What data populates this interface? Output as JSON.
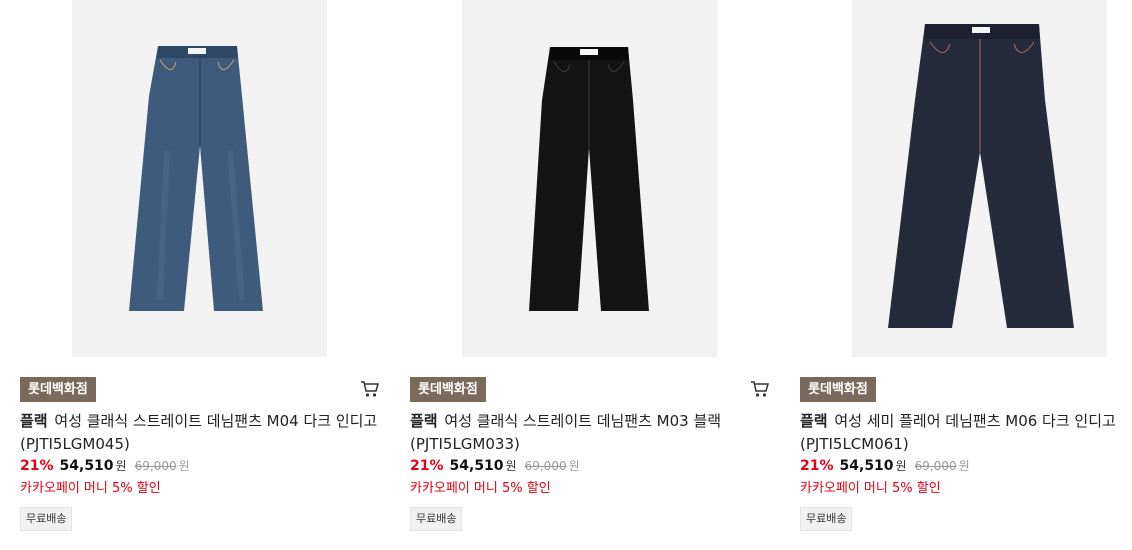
{
  "products": [
    {
      "badge": "롯데백화점",
      "brand": "플랙",
      "name": "여성 클래식 스트레이트 데님팬츠 M04 다크 인디고 (PJTI5LGM045)",
      "discount": "21%",
      "sale_price": "54,510",
      "sale_unit": "원",
      "original_price": "69,000",
      "original_unit": "원",
      "promo": "카카오페이 머니 5% 할인",
      "shipping": "무료배송",
      "image_icon": "jeans-mid-blue",
      "has_cart": true
    },
    {
      "badge": "롯데백화점",
      "brand": "플랙",
      "name": "여성 클래식 스트레이트 데님팬츠 M03 블랙 (PJTI5LGM033)",
      "discount": "21%",
      "sale_price": "54,510",
      "sale_unit": "원",
      "original_price": "69,000",
      "original_unit": "원",
      "promo": "카카오페이 머니 5% 할인",
      "shipping": "무료배송",
      "image_icon": "jeans-black",
      "has_cart": true
    },
    {
      "badge": "롯데백화점",
      "brand": "플랙",
      "name": "여성 세미 플레어 데님팬츠 M06 다크 인디고 (PJTI5LCM061)",
      "discount": "21%",
      "sale_price": "54,510",
      "sale_unit": "원",
      "original_price": "69,000",
      "original_unit": "원",
      "promo": "카카오페이 머니 5% 할인",
      "shipping": "무료배송",
      "image_icon": "jeans-dark-indigo",
      "has_cart": false
    }
  ],
  "colors": {
    "badge_bg": "#7a6a5c",
    "discount": "#e60012",
    "promo": "#e60012",
    "jeans_mid_blue": "#3d5a7a",
    "jeans_black": "#141414",
    "jeans_dark_indigo": "#262b3c"
  }
}
